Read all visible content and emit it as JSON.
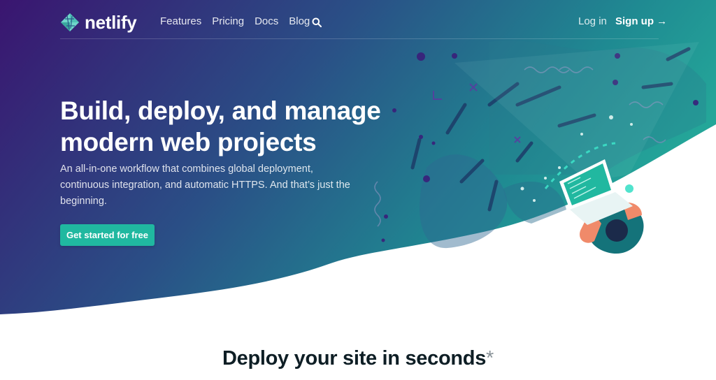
{
  "brand": {
    "name": "netlify",
    "logo_icon": "netlify-diamond-icon"
  },
  "nav": {
    "links": [
      "Features",
      "Pricing",
      "Docs",
      "Blog"
    ],
    "search_icon": "search-icon",
    "login": "Log in",
    "signup": "Sign up →"
  },
  "hero": {
    "headline": "Build, deploy, and manage modern web projects",
    "subcopy": "An all-in-one workflow that combines global deployment, continuous integration, and automatic HTTPS. And that’s just the beginning.",
    "cta": "Get started for free"
  },
  "section": {
    "heading": "Deploy your site in seconds",
    "asterisk": "*"
  },
  "colors": {
    "gradient_start": "#3a1a6e",
    "gradient_mid": "#2b5a8a",
    "gradient_end": "#20a39a",
    "accent": "#20b8a0",
    "heading_dark": "#0e1e25"
  }
}
